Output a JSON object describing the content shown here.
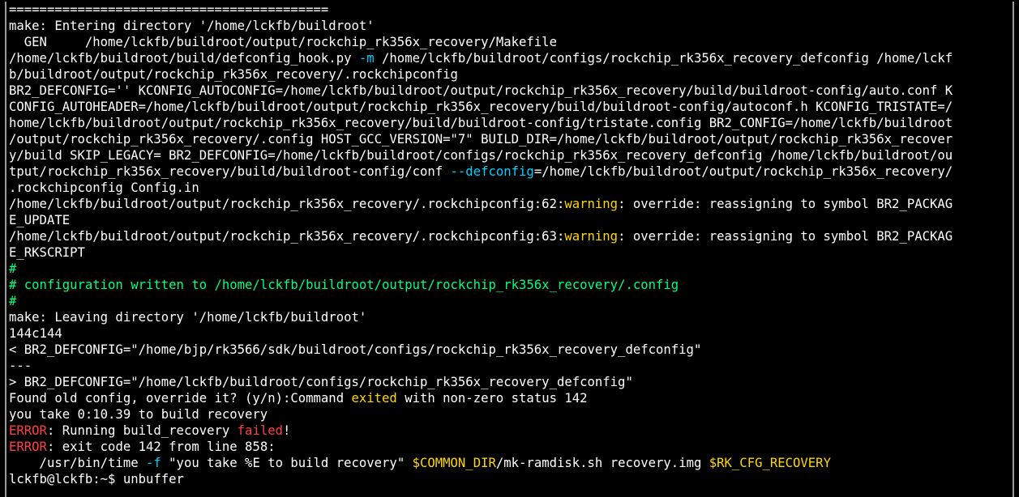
{
  "colors": {
    "background": "#000000",
    "default": "#ffffff",
    "green": "#00ff7f",
    "yellow": "#ffd700",
    "red": "#ff4040",
    "cyan": "#00d0ff",
    "border": "#9a9a9a"
  },
  "terminal": {
    "prompt": "lckfb@lckfb:~$ ",
    "current_command": "unbuffer",
    "lines": [
      [
        {
          "t": "=========================================="
        }
      ],
      [
        {
          "t": "make: Entering directory '/home/lckfb/buildroot'"
        }
      ],
      [
        {
          "t": "  GEN     /home/lckfb/buildroot/output/rockchip_rk356x_recovery/Makefile"
        }
      ],
      [
        {
          "t": "/home/lckfb/buildroot/build/defconfig_hook.py "
        },
        {
          "t": "-m",
          "c": "cyan"
        },
        {
          "t": " /home/lckfb/buildroot/configs/rockchip_rk356x_recovery_defconfig /home/lckf"
        }
      ],
      [
        {
          "t": "b/buildroot/output/rockchip_rk356x_recovery/.rockchipconfig"
        }
      ],
      [
        {
          "t": "BR2_DEFCONFIG='' KCONFIG_AUTOCONFIG=/home/lckfb/buildroot/output/rockchip_rk356x_recovery/build/buildroot-config/auto.conf K"
        }
      ],
      [
        {
          "t": "CONFIG_AUTOHEADER=/home/lckfb/buildroot/output/rockchip_rk356x_recovery/build/buildroot-config/autoconf.h KCONFIG_TRISTATE=/"
        }
      ],
      [
        {
          "t": "home/lckfb/buildroot/output/rockchip_rk356x_recovery/build/buildroot-config/tristate.config BR2_CONFIG=/home/lckfb/buildroot"
        }
      ],
      [
        {
          "t": "/output/rockchip_rk356x_recovery/.config HOST_GCC_VERSION=\"7\" BUILD_DIR=/home/lckfb/buildroot/output/rockchip_rk356x_recover"
        }
      ],
      [
        {
          "t": "y/build SKIP_LEGACY= BR2_DEFCONFIG=/home/lckfb/buildroot/configs/rockchip_rk356x_recovery_defconfig /home/lckfb/buildroot/ou"
        }
      ],
      [
        {
          "t": "tput/rockchip_rk356x_recovery/build/buildroot-config/conf "
        },
        {
          "t": "--defconfig",
          "c": "cyan"
        },
        {
          "t": "=/home/lckfb/buildroot/output/rockchip_rk356x_recovery/"
        }
      ],
      [
        {
          "t": ".rockchipconfig Config.in"
        }
      ],
      [
        {
          "t": "/home/lckfb/buildroot/output/rockchip_rk356x_recovery/.rockchipconfig:62:"
        },
        {
          "t": "warning",
          "c": "yellow"
        },
        {
          "t": ": override: reassigning to symbol BR2_PACKAG"
        }
      ],
      [
        {
          "t": "E_UPDATE"
        }
      ],
      [
        {
          "t": "/home/lckfb/buildroot/output/rockchip_rk356x_recovery/.rockchipconfig:63:"
        },
        {
          "t": "warning",
          "c": "yellow"
        },
        {
          "t": ": override: reassigning to symbol BR2_PACKAG"
        }
      ],
      [
        {
          "t": "E_RKSCRIPT"
        }
      ],
      [
        {
          "t": "#",
          "c": "green"
        }
      ],
      [
        {
          "t": "# configuration written to /home/lckfb/buildroot/output/rockchip_rk356x_recovery/.config",
          "c": "green"
        }
      ],
      [
        {
          "t": "#",
          "c": "green"
        }
      ],
      [
        {
          "t": "make: Leaving directory '/home/lckfb/buildroot'"
        }
      ],
      [
        {
          "t": "144c144"
        }
      ],
      [
        {
          "t": "< BR2_DEFCONFIG=\"/home/bjp/rk3566/sdk/buildroot/configs/rockchip_rk356x_recovery_defconfig\""
        }
      ],
      [
        {
          "t": "---"
        }
      ],
      [
        {
          "t": "> BR2_DEFCONFIG=\"/home/lckfb/buildroot/configs/rockchip_rk356x_recovery_defconfig\""
        }
      ],
      [
        {
          "t": "Found old config, override it? (y/n):Command "
        },
        {
          "t": "exited",
          "c": "yellow"
        },
        {
          "t": " with non-zero status 142"
        }
      ],
      [
        {
          "t": "you take 0:10.39 to build recovery"
        }
      ],
      [
        {
          "t": "ERROR",
          "c": "red"
        },
        {
          "t": ": Running build_recovery "
        },
        {
          "t": "failed",
          "c": "red"
        },
        {
          "t": "!"
        }
      ],
      [
        {
          "t": "ERROR",
          "c": "red"
        },
        {
          "t": ": exit code 142 from line 858:"
        }
      ],
      [
        {
          "t": "    /usr/bin/time "
        },
        {
          "t": "-f",
          "c": "cyan"
        },
        {
          "t": " \"you take %E to build recovery\" "
        },
        {
          "t": "$COMMON_DIR",
          "c": "yellow"
        },
        {
          "t": "/mk-ramdisk.sh recovery.img "
        },
        {
          "t": "$RK_CFG_RECOVERY",
          "c": "yellow"
        }
      ]
    ]
  }
}
